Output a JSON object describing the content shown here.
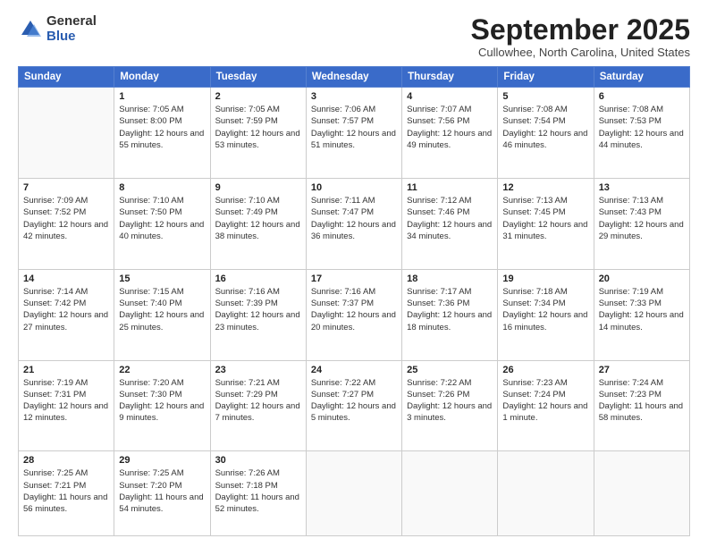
{
  "logo": {
    "general": "General",
    "blue": "Blue"
  },
  "header": {
    "month": "September 2025",
    "location": "Cullowhee, North Carolina, United States"
  },
  "weekdays": [
    "Sunday",
    "Monday",
    "Tuesday",
    "Wednesday",
    "Thursday",
    "Friday",
    "Saturday"
  ],
  "weeks": [
    [
      {
        "day": "",
        "sunrise": "",
        "sunset": "",
        "daylight": ""
      },
      {
        "day": "1",
        "sunrise": "Sunrise: 7:05 AM",
        "sunset": "Sunset: 8:00 PM",
        "daylight": "Daylight: 12 hours and 55 minutes."
      },
      {
        "day": "2",
        "sunrise": "Sunrise: 7:05 AM",
        "sunset": "Sunset: 7:59 PM",
        "daylight": "Daylight: 12 hours and 53 minutes."
      },
      {
        "day": "3",
        "sunrise": "Sunrise: 7:06 AM",
        "sunset": "Sunset: 7:57 PM",
        "daylight": "Daylight: 12 hours and 51 minutes."
      },
      {
        "day": "4",
        "sunrise": "Sunrise: 7:07 AM",
        "sunset": "Sunset: 7:56 PM",
        "daylight": "Daylight: 12 hours and 49 minutes."
      },
      {
        "day": "5",
        "sunrise": "Sunrise: 7:08 AM",
        "sunset": "Sunset: 7:54 PM",
        "daylight": "Daylight: 12 hours and 46 minutes."
      },
      {
        "day": "6",
        "sunrise": "Sunrise: 7:08 AM",
        "sunset": "Sunset: 7:53 PM",
        "daylight": "Daylight: 12 hours and 44 minutes."
      }
    ],
    [
      {
        "day": "7",
        "sunrise": "Sunrise: 7:09 AM",
        "sunset": "Sunset: 7:52 PM",
        "daylight": "Daylight: 12 hours and 42 minutes."
      },
      {
        "day": "8",
        "sunrise": "Sunrise: 7:10 AM",
        "sunset": "Sunset: 7:50 PM",
        "daylight": "Daylight: 12 hours and 40 minutes."
      },
      {
        "day": "9",
        "sunrise": "Sunrise: 7:10 AM",
        "sunset": "Sunset: 7:49 PM",
        "daylight": "Daylight: 12 hours and 38 minutes."
      },
      {
        "day": "10",
        "sunrise": "Sunrise: 7:11 AM",
        "sunset": "Sunset: 7:47 PM",
        "daylight": "Daylight: 12 hours and 36 minutes."
      },
      {
        "day": "11",
        "sunrise": "Sunrise: 7:12 AM",
        "sunset": "Sunset: 7:46 PM",
        "daylight": "Daylight: 12 hours and 34 minutes."
      },
      {
        "day": "12",
        "sunrise": "Sunrise: 7:13 AM",
        "sunset": "Sunset: 7:45 PM",
        "daylight": "Daylight: 12 hours and 31 minutes."
      },
      {
        "day": "13",
        "sunrise": "Sunrise: 7:13 AM",
        "sunset": "Sunset: 7:43 PM",
        "daylight": "Daylight: 12 hours and 29 minutes."
      }
    ],
    [
      {
        "day": "14",
        "sunrise": "Sunrise: 7:14 AM",
        "sunset": "Sunset: 7:42 PM",
        "daylight": "Daylight: 12 hours and 27 minutes."
      },
      {
        "day": "15",
        "sunrise": "Sunrise: 7:15 AM",
        "sunset": "Sunset: 7:40 PM",
        "daylight": "Daylight: 12 hours and 25 minutes."
      },
      {
        "day": "16",
        "sunrise": "Sunrise: 7:16 AM",
        "sunset": "Sunset: 7:39 PM",
        "daylight": "Daylight: 12 hours and 23 minutes."
      },
      {
        "day": "17",
        "sunrise": "Sunrise: 7:16 AM",
        "sunset": "Sunset: 7:37 PM",
        "daylight": "Daylight: 12 hours and 20 minutes."
      },
      {
        "day": "18",
        "sunrise": "Sunrise: 7:17 AM",
        "sunset": "Sunset: 7:36 PM",
        "daylight": "Daylight: 12 hours and 18 minutes."
      },
      {
        "day": "19",
        "sunrise": "Sunrise: 7:18 AM",
        "sunset": "Sunset: 7:34 PM",
        "daylight": "Daylight: 12 hours and 16 minutes."
      },
      {
        "day": "20",
        "sunrise": "Sunrise: 7:19 AM",
        "sunset": "Sunset: 7:33 PM",
        "daylight": "Daylight: 12 hours and 14 minutes."
      }
    ],
    [
      {
        "day": "21",
        "sunrise": "Sunrise: 7:19 AM",
        "sunset": "Sunset: 7:31 PM",
        "daylight": "Daylight: 12 hours and 12 minutes."
      },
      {
        "day": "22",
        "sunrise": "Sunrise: 7:20 AM",
        "sunset": "Sunset: 7:30 PM",
        "daylight": "Daylight: 12 hours and 9 minutes."
      },
      {
        "day": "23",
        "sunrise": "Sunrise: 7:21 AM",
        "sunset": "Sunset: 7:29 PM",
        "daylight": "Daylight: 12 hours and 7 minutes."
      },
      {
        "day": "24",
        "sunrise": "Sunrise: 7:22 AM",
        "sunset": "Sunset: 7:27 PM",
        "daylight": "Daylight: 12 hours and 5 minutes."
      },
      {
        "day": "25",
        "sunrise": "Sunrise: 7:22 AM",
        "sunset": "Sunset: 7:26 PM",
        "daylight": "Daylight: 12 hours and 3 minutes."
      },
      {
        "day": "26",
        "sunrise": "Sunrise: 7:23 AM",
        "sunset": "Sunset: 7:24 PM",
        "daylight": "Daylight: 12 hours and 1 minute."
      },
      {
        "day": "27",
        "sunrise": "Sunrise: 7:24 AM",
        "sunset": "Sunset: 7:23 PM",
        "daylight": "Daylight: 11 hours and 58 minutes."
      }
    ],
    [
      {
        "day": "28",
        "sunrise": "Sunrise: 7:25 AM",
        "sunset": "Sunset: 7:21 PM",
        "daylight": "Daylight: 11 hours and 56 minutes."
      },
      {
        "day": "29",
        "sunrise": "Sunrise: 7:25 AM",
        "sunset": "Sunset: 7:20 PM",
        "daylight": "Daylight: 11 hours and 54 minutes."
      },
      {
        "day": "30",
        "sunrise": "Sunrise: 7:26 AM",
        "sunset": "Sunset: 7:18 PM",
        "daylight": "Daylight: 11 hours and 52 minutes."
      },
      {
        "day": "",
        "sunrise": "",
        "sunset": "",
        "daylight": ""
      },
      {
        "day": "",
        "sunrise": "",
        "sunset": "",
        "daylight": ""
      },
      {
        "day": "",
        "sunrise": "",
        "sunset": "",
        "daylight": ""
      },
      {
        "day": "",
        "sunrise": "",
        "sunset": "",
        "daylight": ""
      }
    ]
  ]
}
